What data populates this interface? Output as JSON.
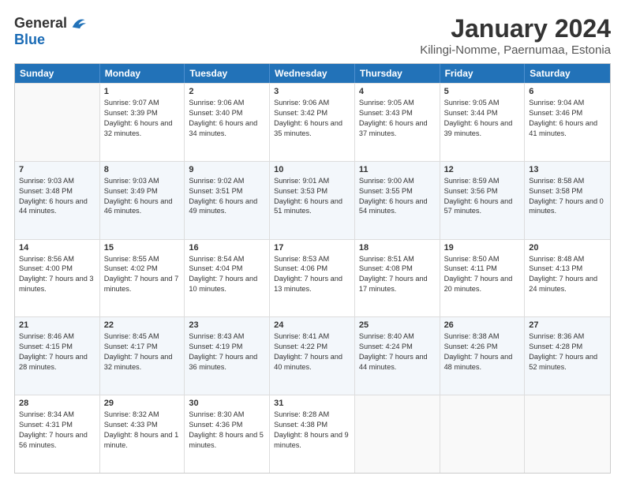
{
  "logo": {
    "general": "General",
    "blue": "Blue"
  },
  "header": {
    "month": "January 2024",
    "location": "Kilingi-Nomme, Paernumaa, Estonia"
  },
  "days": [
    "Sunday",
    "Monday",
    "Tuesday",
    "Wednesday",
    "Thursday",
    "Friday",
    "Saturday"
  ],
  "weeks": [
    [
      {
        "day": "",
        "sunrise": "",
        "sunset": "",
        "daylight": "",
        "empty": true
      },
      {
        "day": "1",
        "sunrise": "Sunrise: 9:07 AM",
        "sunset": "Sunset: 3:39 PM",
        "daylight": "Daylight: 6 hours and 32 minutes."
      },
      {
        "day": "2",
        "sunrise": "Sunrise: 9:06 AM",
        "sunset": "Sunset: 3:40 PM",
        "daylight": "Daylight: 6 hours and 34 minutes."
      },
      {
        "day": "3",
        "sunrise": "Sunrise: 9:06 AM",
        "sunset": "Sunset: 3:42 PM",
        "daylight": "Daylight: 6 hours and 35 minutes."
      },
      {
        "day": "4",
        "sunrise": "Sunrise: 9:05 AM",
        "sunset": "Sunset: 3:43 PM",
        "daylight": "Daylight: 6 hours and 37 minutes."
      },
      {
        "day": "5",
        "sunrise": "Sunrise: 9:05 AM",
        "sunset": "Sunset: 3:44 PM",
        "daylight": "Daylight: 6 hours and 39 minutes."
      },
      {
        "day": "6",
        "sunrise": "Sunrise: 9:04 AM",
        "sunset": "Sunset: 3:46 PM",
        "daylight": "Daylight: 6 hours and 41 minutes."
      }
    ],
    [
      {
        "day": "7",
        "sunrise": "Sunrise: 9:03 AM",
        "sunset": "Sunset: 3:48 PM",
        "daylight": "Daylight: 6 hours and 44 minutes."
      },
      {
        "day": "8",
        "sunrise": "Sunrise: 9:03 AM",
        "sunset": "Sunset: 3:49 PM",
        "daylight": "Daylight: 6 hours and 46 minutes."
      },
      {
        "day": "9",
        "sunrise": "Sunrise: 9:02 AM",
        "sunset": "Sunset: 3:51 PM",
        "daylight": "Daylight: 6 hours and 49 minutes."
      },
      {
        "day": "10",
        "sunrise": "Sunrise: 9:01 AM",
        "sunset": "Sunset: 3:53 PM",
        "daylight": "Daylight: 6 hours and 51 minutes."
      },
      {
        "day": "11",
        "sunrise": "Sunrise: 9:00 AM",
        "sunset": "Sunset: 3:55 PM",
        "daylight": "Daylight: 6 hours and 54 minutes."
      },
      {
        "day": "12",
        "sunrise": "Sunrise: 8:59 AM",
        "sunset": "Sunset: 3:56 PM",
        "daylight": "Daylight: 6 hours and 57 minutes."
      },
      {
        "day": "13",
        "sunrise": "Sunrise: 8:58 AM",
        "sunset": "Sunset: 3:58 PM",
        "daylight": "Daylight: 7 hours and 0 minutes."
      }
    ],
    [
      {
        "day": "14",
        "sunrise": "Sunrise: 8:56 AM",
        "sunset": "Sunset: 4:00 PM",
        "daylight": "Daylight: 7 hours and 3 minutes."
      },
      {
        "day": "15",
        "sunrise": "Sunrise: 8:55 AM",
        "sunset": "Sunset: 4:02 PM",
        "daylight": "Daylight: 7 hours and 7 minutes."
      },
      {
        "day": "16",
        "sunrise": "Sunrise: 8:54 AM",
        "sunset": "Sunset: 4:04 PM",
        "daylight": "Daylight: 7 hours and 10 minutes."
      },
      {
        "day": "17",
        "sunrise": "Sunrise: 8:53 AM",
        "sunset": "Sunset: 4:06 PM",
        "daylight": "Daylight: 7 hours and 13 minutes."
      },
      {
        "day": "18",
        "sunrise": "Sunrise: 8:51 AM",
        "sunset": "Sunset: 4:08 PM",
        "daylight": "Daylight: 7 hours and 17 minutes."
      },
      {
        "day": "19",
        "sunrise": "Sunrise: 8:50 AM",
        "sunset": "Sunset: 4:11 PM",
        "daylight": "Daylight: 7 hours and 20 minutes."
      },
      {
        "day": "20",
        "sunrise": "Sunrise: 8:48 AM",
        "sunset": "Sunset: 4:13 PM",
        "daylight": "Daylight: 7 hours and 24 minutes."
      }
    ],
    [
      {
        "day": "21",
        "sunrise": "Sunrise: 8:46 AM",
        "sunset": "Sunset: 4:15 PM",
        "daylight": "Daylight: 7 hours and 28 minutes."
      },
      {
        "day": "22",
        "sunrise": "Sunrise: 8:45 AM",
        "sunset": "Sunset: 4:17 PM",
        "daylight": "Daylight: 7 hours and 32 minutes."
      },
      {
        "day": "23",
        "sunrise": "Sunrise: 8:43 AM",
        "sunset": "Sunset: 4:19 PM",
        "daylight": "Daylight: 7 hours and 36 minutes."
      },
      {
        "day": "24",
        "sunrise": "Sunrise: 8:41 AM",
        "sunset": "Sunset: 4:22 PM",
        "daylight": "Daylight: 7 hours and 40 minutes."
      },
      {
        "day": "25",
        "sunrise": "Sunrise: 8:40 AM",
        "sunset": "Sunset: 4:24 PM",
        "daylight": "Daylight: 7 hours and 44 minutes."
      },
      {
        "day": "26",
        "sunrise": "Sunrise: 8:38 AM",
        "sunset": "Sunset: 4:26 PM",
        "daylight": "Daylight: 7 hours and 48 minutes."
      },
      {
        "day": "27",
        "sunrise": "Sunrise: 8:36 AM",
        "sunset": "Sunset: 4:28 PM",
        "daylight": "Daylight: 7 hours and 52 minutes."
      }
    ],
    [
      {
        "day": "28",
        "sunrise": "Sunrise: 8:34 AM",
        "sunset": "Sunset: 4:31 PM",
        "daylight": "Daylight: 7 hours and 56 minutes."
      },
      {
        "day": "29",
        "sunrise": "Sunrise: 8:32 AM",
        "sunset": "Sunset: 4:33 PM",
        "daylight": "Daylight: 8 hours and 1 minute."
      },
      {
        "day": "30",
        "sunrise": "Sunrise: 8:30 AM",
        "sunset": "Sunset: 4:36 PM",
        "daylight": "Daylight: 8 hours and 5 minutes."
      },
      {
        "day": "31",
        "sunrise": "Sunrise: 8:28 AM",
        "sunset": "Sunset: 4:38 PM",
        "daylight": "Daylight: 8 hours and 9 minutes."
      },
      {
        "day": "",
        "sunrise": "",
        "sunset": "",
        "daylight": "",
        "empty": true
      },
      {
        "day": "",
        "sunrise": "",
        "sunset": "",
        "daylight": "",
        "empty": true
      },
      {
        "day": "",
        "sunrise": "",
        "sunset": "",
        "daylight": "",
        "empty": true
      }
    ]
  ]
}
